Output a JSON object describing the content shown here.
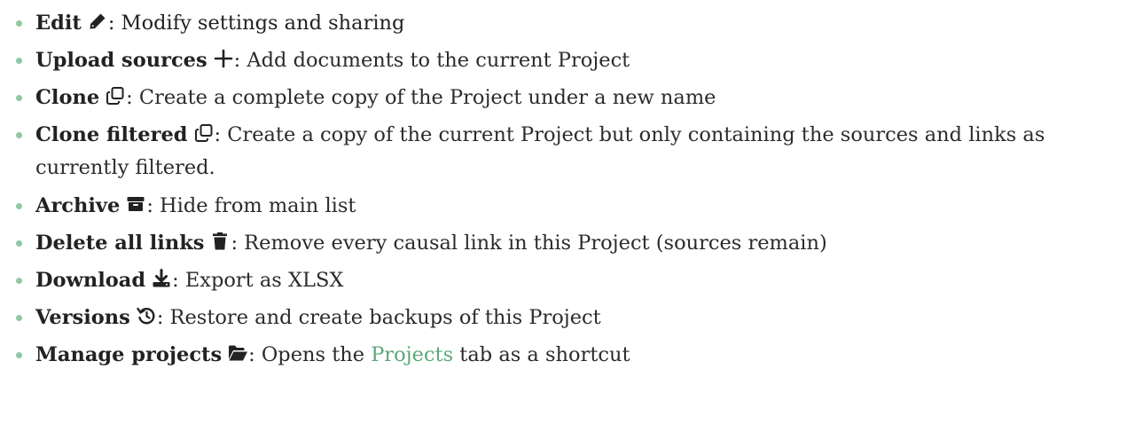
{
  "items": [
    {
      "name": "Edit",
      "icon": "pencil-icon",
      "desc": ": Modify settings and sharing"
    },
    {
      "name": "Upload sources",
      "icon": "plus-icon",
      "desc": ": Add documents to the current Project"
    },
    {
      "name": "Clone",
      "icon": "clone-icon",
      "desc": ": Create a complete copy of the Project under a new name"
    },
    {
      "name": "Clone filtered",
      "icon": "clone-icon",
      "desc": ": Create a copy of the current Project but only containing the sources and links as currently filtered."
    },
    {
      "name": "Archive",
      "icon": "archive-box-icon",
      "desc": ": Hide from main list"
    },
    {
      "name": "Delete all links",
      "icon": "trash-icon",
      "desc": ": Remove every causal link in this Project (sources remain)"
    },
    {
      "name": "Download",
      "icon": "download-icon",
      "desc": ": Export as XLSX"
    },
    {
      "name": "Versions",
      "icon": "history-icon",
      "desc": ": Restore and create backups of this Project"
    },
    {
      "name": "Manage projects",
      "icon": "folder-open-icon",
      "desc_before": ": Opens the ",
      "link": "Projects",
      "desc_after": " tab as a shortcut"
    }
  ],
  "colors": {
    "bullet": "#8ec9a2",
    "link": "#5aa877",
    "text": "#2b2b2b"
  }
}
